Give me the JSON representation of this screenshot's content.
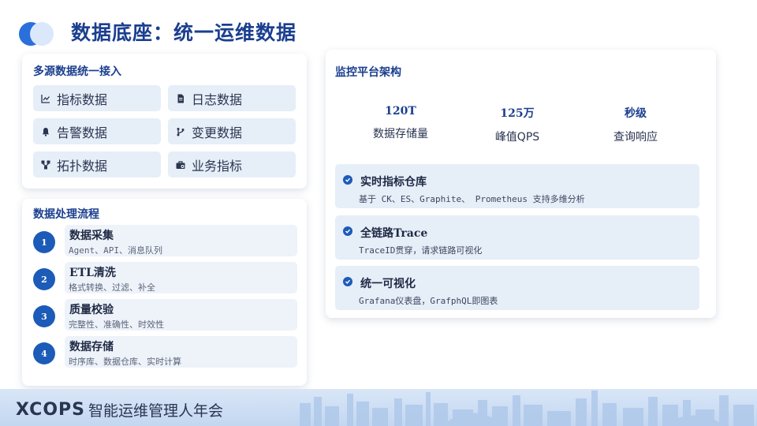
{
  "header": {
    "title": "数据底座：统一运维数据"
  },
  "sources": {
    "title": "多源数据统一接入",
    "items": [
      {
        "label": "指标数据",
        "icon": "line-chart-icon"
      },
      {
        "label": "日志数据",
        "icon": "document-icon"
      },
      {
        "label": "告警数据",
        "icon": "bell-icon"
      },
      {
        "label": "变更数据",
        "icon": "branch-icon"
      },
      {
        "label": "拓扑数据",
        "icon": "topology-icon"
      },
      {
        "label": "业务指标",
        "icon": "briefcase-icon"
      }
    ]
  },
  "process": {
    "title": "数据处理流程",
    "steps": [
      {
        "num": "1",
        "title": "数据采集",
        "desc": "Agent、API、消息队列"
      },
      {
        "num": "2",
        "title": "ETL清洗",
        "desc": "格式转换、过滤、补全"
      },
      {
        "num": "3",
        "title": "质量校验",
        "desc": "完整性、准确性、时效性"
      },
      {
        "num": "4",
        "title": "数据存储",
        "desc": "时序库、数据仓库、实时计算"
      }
    ]
  },
  "platform": {
    "title": "监控平台架构",
    "stats": [
      {
        "value": "120T",
        "label": "数据存储量"
      },
      {
        "value": "125万",
        "label": "峰值QPS"
      },
      {
        "value": "秒级",
        "label": "查询响应"
      }
    ],
    "features": [
      {
        "title": "实时指标仓库",
        "desc": "基于 CK、ES、Graphite、 Prometheus 支持多维分析"
      },
      {
        "title": "全链路Trace",
        "desc": "TraceID贯穿，请求链路可视化"
      },
      {
        "title": "统一可视化",
        "desc": "Grafana仪表盘，GrafphQL即图表"
      }
    ]
  },
  "footer": {
    "brand_logo": "XCOPS",
    "brand_name": "智能运维管理人年会"
  },
  "colors": {
    "primary": "#1b3f8f",
    "accent": "#1c5bb8",
    "tile": "#e6eef8"
  }
}
